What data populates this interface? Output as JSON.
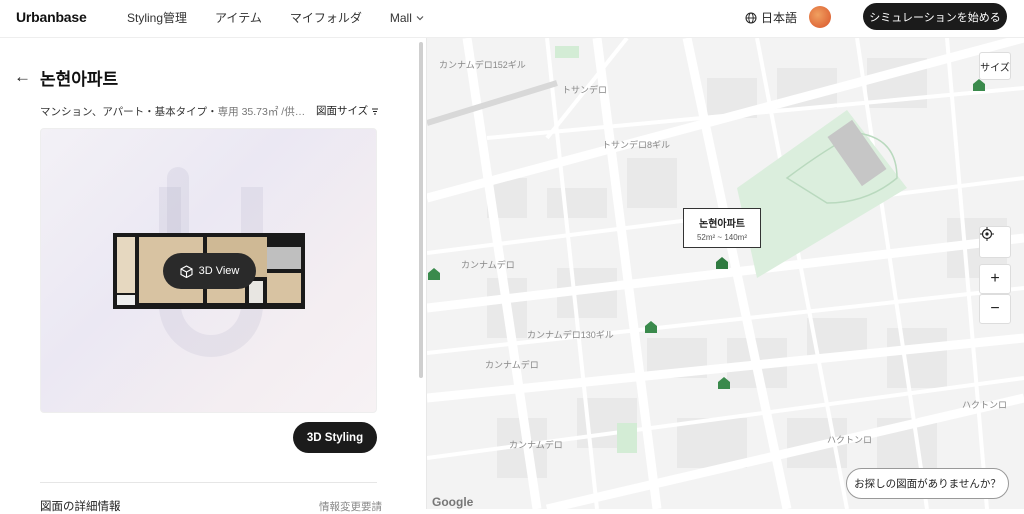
{
  "header": {
    "logo": "Urbanbase",
    "nav": [
      "Styling管理",
      "アイテム",
      "マイフォルダ",
      "Mall"
    ],
    "language": "日本語",
    "cta": "シミュレーションを始める"
  },
  "panel": {
    "title": "논현아파트",
    "meta_main": "マンション、アパート・基本タイプ・",
    "meta_muted": "専用 35.73㎡ /供…",
    "size_button": "図面サイズ",
    "view3d": "3D View",
    "styling_button": "3D Styling",
    "detail_heading": "図面の詳細情報",
    "change_link": "情報変更要請"
  },
  "map": {
    "size_button": "サイズ",
    "popup_name": "논현아파트",
    "popup_range": "52m² ~ 140m²",
    "find_button": "お探しの図面がありませんか？",
    "google": "Google",
    "street_labels": [
      "カンナムデロ152ギル",
      "トサンデロ",
      "トサンデロ8ギル",
      "カンナムデロ",
      "カンナムデロ",
      "カンナムデロ",
      "ハクトンロ",
      "ハクトンロ",
      "カンナムデロ130ギル"
    ],
    "markers": 5
  },
  "colors": {
    "accent": "#1b1b1b",
    "park": "#dbeedd",
    "marker": "#3a8a4c"
  },
  "icons": {
    "back": "arrow-left-icon",
    "globe": "globe-icon",
    "chevron": "chevron-down-icon",
    "cube": "cube-icon",
    "locate": "locate-icon"
  }
}
